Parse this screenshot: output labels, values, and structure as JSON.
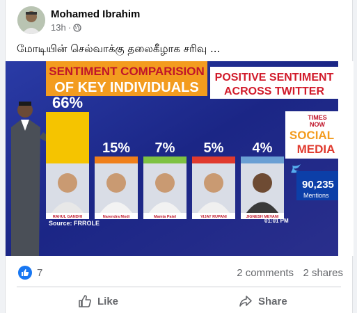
{
  "post": {
    "author": "Mohamed Ibrahim",
    "time": "13h",
    "dot": "·",
    "audience_icon": "globe-icon",
    "text": "மோடியின் செல்வாக்கு தலைகீழாக சரிவு ...",
    "more_icon": "more-dots-icon"
  },
  "photo": {
    "title_line1": "SENTIMENT COMPARISION",
    "title_line2": "OF KEY INDIVIDUALS",
    "subtitle_line1": "POSITIVE SENTIMENT",
    "subtitle_line2": "ACROSS TWITTER",
    "source": "Source: FRROLE",
    "time": "01:01 PM",
    "brand_top": "TIMES",
    "brand_now": "NOW",
    "brand_social": "SOCIAL",
    "brand_media": "MEDIA",
    "twitter_icon": "twitter-icon",
    "mentions_value": "90,235",
    "mentions_label": "Mentions",
    "bars": [
      {
        "pct": "66%",
        "value": 66,
        "name": "RAHUL GANDHI",
        "color": "#f5c400",
        "shirt": "#e8e8e8"
      },
      {
        "pct": "15%",
        "value": 15,
        "name": "Narendra Modi",
        "color": "#ef7f1a",
        "shirt": "#f3f3f3"
      },
      {
        "pct": "7%",
        "value": 7,
        "name": "Mamta Patel",
        "color": "#7ec242",
        "shirt": "#f2f2f2"
      },
      {
        "pct": "5%",
        "value": 5,
        "name": "VIJAY RUPANI",
        "color": "#e03a2e",
        "shirt": "#f0f0f0"
      },
      {
        "pct": "4%",
        "value": 4,
        "name": "JIGNESH MEVANI",
        "color": "#6a9fd4",
        "shirt": "#3a3a3a"
      }
    ]
  },
  "engagement": {
    "reaction_icon": "like-reaction-icon",
    "reaction_count": "7",
    "comments": "2 comments",
    "shares": "2 shares"
  },
  "actions": {
    "like_label": "Like",
    "like_icon": "thumbs-up-icon",
    "share_label": "Share",
    "share_icon": "share-arrow-icon"
  },
  "colors": {
    "studio_bg": "#1c2a8a",
    "title_bar": "#f39c1f",
    "title_text": "#c0152a",
    "subtitle_bg": "#ffffff",
    "subtitle_text": "#d11a2a",
    "facebook_blue": "#1877f2"
  }
}
